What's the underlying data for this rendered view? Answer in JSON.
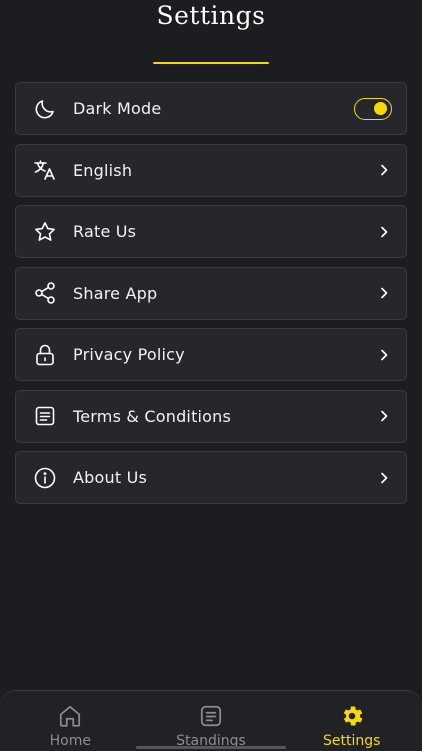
{
  "header": {
    "title": "Settings"
  },
  "settings": {
    "items": [
      {
        "label": "Dark Mode",
        "icon": "moon-icon",
        "control": "toggle",
        "toggle_on": true
      },
      {
        "label": "English",
        "icon": "translate-icon",
        "control": "chevron"
      },
      {
        "label": "Rate Us",
        "icon": "star-icon",
        "control": "chevron"
      },
      {
        "label": "Share App",
        "icon": "share-icon",
        "control": "chevron"
      },
      {
        "label": "Privacy Policy",
        "icon": "lock-icon",
        "control": "chevron"
      },
      {
        "label": "Terms & Conditions",
        "icon": "document-icon",
        "control": "chevron"
      },
      {
        "label": "About Us",
        "icon": "info-icon",
        "control": "chevron"
      }
    ]
  },
  "nav": {
    "items": [
      {
        "label": "Home",
        "icon": "home-icon",
        "active": false
      },
      {
        "label": "Standings",
        "icon": "standings-icon",
        "active": false
      },
      {
        "label": "Settings",
        "icon": "gear-icon",
        "active": true
      }
    ]
  },
  "colors": {
    "background": "#1c1d21",
    "card": "#26272c",
    "accent": "#f5d90a",
    "inactive": "#8c8d93"
  }
}
